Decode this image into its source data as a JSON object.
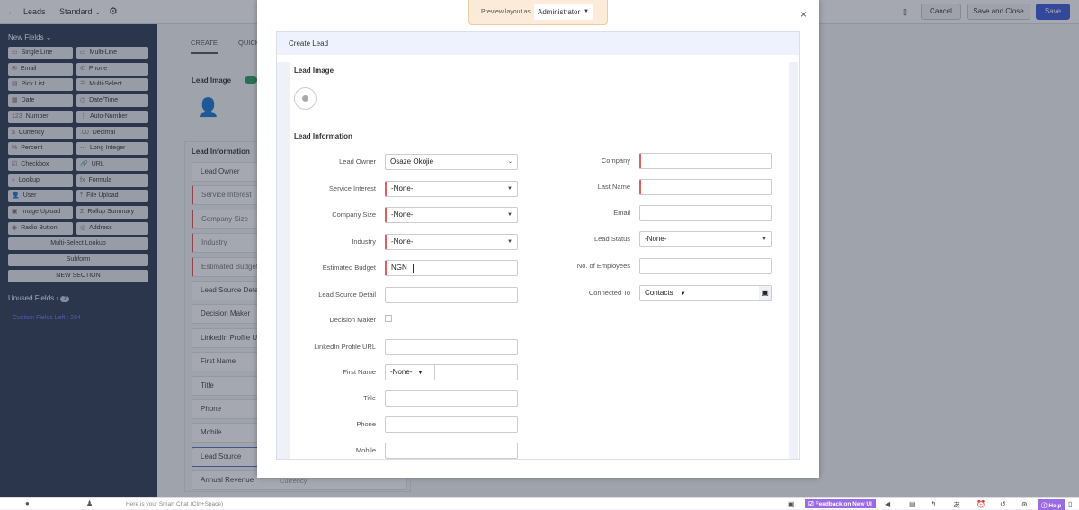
{
  "topbar": {
    "back": "←",
    "module": "Leads",
    "layout": "Standard",
    "cancel": "Cancel",
    "save_close": "Save and Close",
    "save": "Save"
  },
  "sidebar": {
    "new_fields": "New Fields",
    "fields": [
      "Single Line",
      "Multi-Line",
      "Email",
      "Phone",
      "Pick List",
      "Multi-Select",
      "Date",
      "Date/Time",
      "Number",
      "Auto-Number",
      "Currency",
      "Decimal",
      "Percent",
      "Long Integer",
      "Checkbox",
      "URL",
      "Lookup",
      "Formula",
      "User",
      "File Upload",
      "Image Upload",
      "Rollup Summary",
      "Radio Button",
      "Address"
    ],
    "icons": [
      "▭",
      "▭",
      "✉",
      "✆",
      "▤",
      "☰",
      "▦",
      "◷",
      "123",
      "⋮",
      "$",
      ".00",
      "%",
      "⋯",
      "☑",
      "🔗",
      "⌕",
      "fx",
      "👤",
      "⤒",
      "▣",
      "Σ",
      "◉",
      "◎"
    ],
    "wide": [
      "Multi-Select Lookup",
      "Subform",
      "NEW SECTION"
    ],
    "unused": "Unused Fields",
    "unused_count": "7",
    "custom_left": "Custom Fields Left : 294"
  },
  "canvas": {
    "tabs": [
      "CREATE",
      "QUICK"
    ],
    "lead_image": "Lead Image",
    "lead_info": "Lead Information",
    "fields": [
      {
        "l": "Lead Owner",
        "r": false
      },
      {
        "l": "Service Interest",
        "r": true
      },
      {
        "l": "Company Size",
        "r": true
      },
      {
        "l": "Industry",
        "r": true
      },
      {
        "l": "Estimated Budget",
        "r": true
      },
      {
        "l": "Lead Source Detail",
        "r": false
      },
      {
        "l": "Decision Maker",
        "r": false
      },
      {
        "l": "LinkedIn Profile URL",
        "r": false
      },
      {
        "l": "First Name",
        "r": false
      },
      {
        "l": "Title",
        "r": false
      },
      {
        "l": "Phone",
        "r": false
      },
      {
        "l": "Mobile",
        "r": false
      },
      {
        "l": "Lead Source",
        "r": false
      },
      {
        "l": "Annual Revenue",
        "r": false
      }
    ],
    "currency_hint": "Currency"
  },
  "modal": {
    "preview_label": "Preview layout as",
    "preview_value": "Administrator",
    "close": "×",
    "title": "Create Lead",
    "lead_image": "Lead Image",
    "lead_info": "Lead Information",
    "left": [
      {
        "label": "Lead Owner",
        "value": "Osaze Okojie",
        "type": "lookup",
        "req": false
      },
      {
        "label": "Service Interest",
        "value": "-None-",
        "type": "select",
        "req": true
      },
      {
        "label": "Company Size",
        "value": "-None-",
        "type": "select",
        "req": true
      },
      {
        "label": "Industry",
        "value": "-None-",
        "type": "select",
        "req": true
      },
      {
        "label": "Estimated Budget",
        "value": "NGN",
        "type": "currency",
        "req": true
      },
      {
        "label": "Lead Source Detail",
        "value": "",
        "type": "text",
        "req": false
      },
      {
        "label": "Decision Maker",
        "value": "",
        "type": "checkbox",
        "req": false
      },
      {
        "label": "LinkedIn Profile URL",
        "value": "",
        "type": "text",
        "req": false
      },
      {
        "label": "First Name",
        "value": "-None-",
        "type": "salutation",
        "req": false
      },
      {
        "label": "Title",
        "value": "",
        "type": "text",
        "req": false
      },
      {
        "label": "Phone",
        "value": "",
        "type": "text",
        "req": false
      },
      {
        "label": "Mobile",
        "value": "",
        "type": "text",
        "req": false
      }
    ],
    "right": [
      {
        "label": "Company",
        "value": "",
        "type": "text",
        "req": true
      },
      {
        "label": "Last Name",
        "value": "",
        "type": "text",
        "req": true
      },
      {
        "label": "Email",
        "value": "",
        "type": "text",
        "req": false
      },
      {
        "label": "Lead Status",
        "value": "-None-",
        "type": "select",
        "req": false
      },
      {
        "label": "No. of Employees",
        "value": "",
        "type": "text",
        "req": false
      },
      {
        "label": "Connected To",
        "value": "Contacts",
        "type": "connected",
        "req": false
      }
    ]
  },
  "bottombar": {
    "smart_chat": "Here is your Smart Chat (Ctrl+Space)",
    "feedback": "Feedback on New UI",
    "help": "Help"
  },
  "colors": {
    "sidebar": "#2e3b55",
    "primary": "#3b5bd6",
    "required": "#e06060",
    "feedback": "#9c6ae6"
  }
}
